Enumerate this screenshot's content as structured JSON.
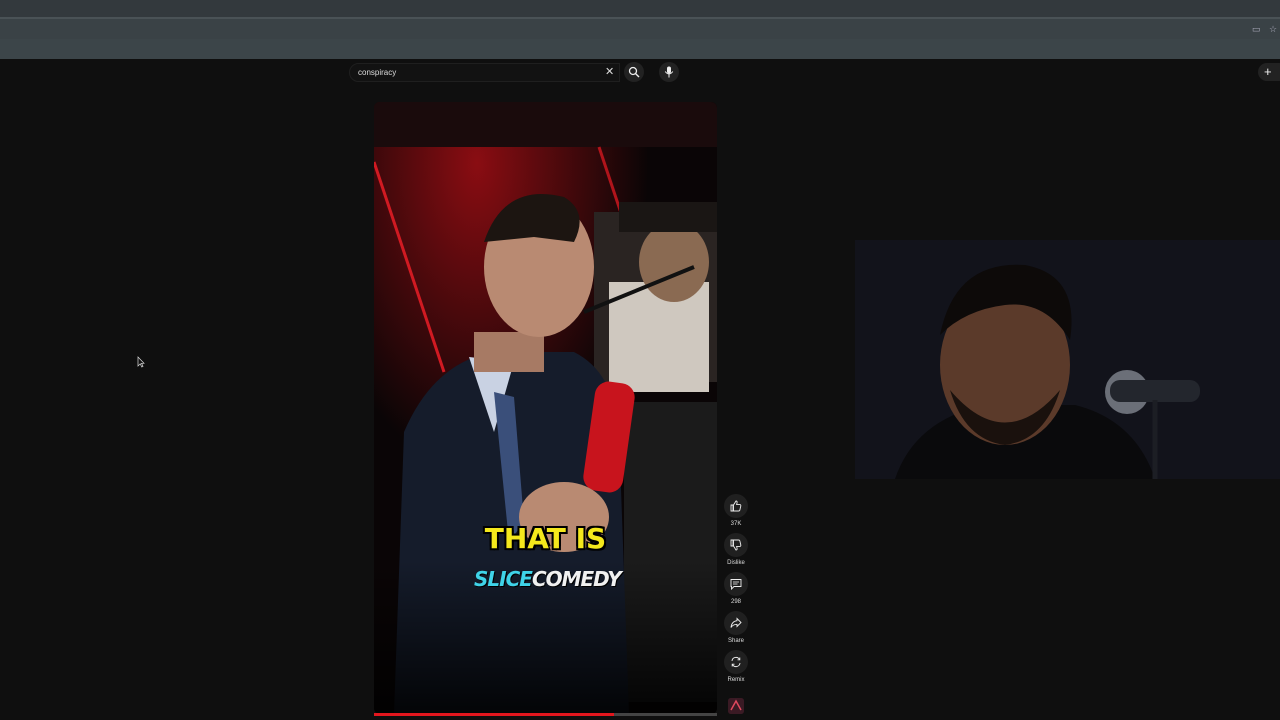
{
  "search": {
    "query": "conspiracy"
  },
  "video": {
    "caption": "THAT IS",
    "watermark_a": "SLICE",
    "watermark_b": "COMEDY",
    "progress": 0.7
  },
  "actions": {
    "like_count": "37K",
    "dislike_label": "Dislike",
    "comment_count": "298",
    "share_label": "Share",
    "remix_label": "Remix"
  },
  "icons": [
    "close-icon",
    "search-icon",
    "microphone-icon",
    "plus-icon",
    "thumbs-up-icon",
    "thumbs-down-icon",
    "comment-icon",
    "share-icon",
    "remix-icon",
    "cursor-icon",
    "cast-icon",
    "star-icon"
  ],
  "colors": {
    "background": "#0f0f0f",
    "caption": "#f4e81c",
    "watermark_a": "#3fd3e8",
    "progress": "#e3161d"
  }
}
